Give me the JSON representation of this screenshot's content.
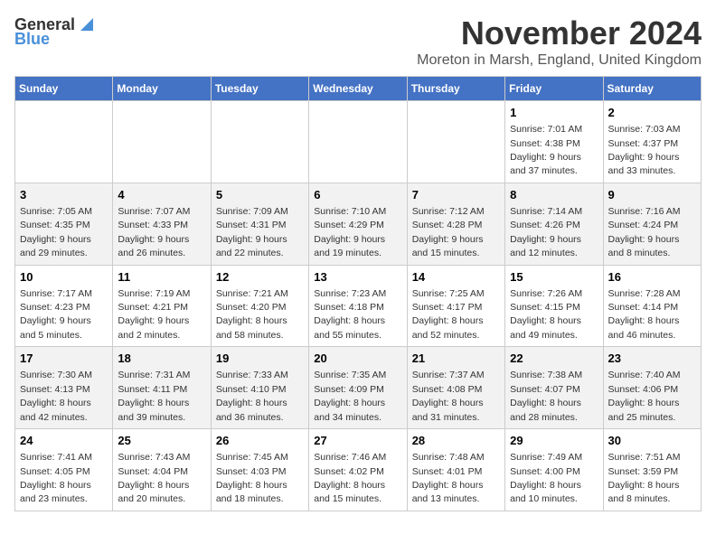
{
  "logo": {
    "general": "General",
    "blue": "Blue"
  },
  "title": "November 2024",
  "location": "Moreton in Marsh, England, United Kingdom",
  "headers": [
    "Sunday",
    "Monday",
    "Tuesday",
    "Wednesday",
    "Thursday",
    "Friday",
    "Saturday"
  ],
  "weeks": [
    [
      {
        "day": "",
        "info": ""
      },
      {
        "day": "",
        "info": ""
      },
      {
        "day": "",
        "info": ""
      },
      {
        "day": "",
        "info": ""
      },
      {
        "day": "",
        "info": ""
      },
      {
        "day": "1",
        "info": "Sunrise: 7:01 AM\nSunset: 4:38 PM\nDaylight: 9 hours\nand 37 minutes."
      },
      {
        "day": "2",
        "info": "Sunrise: 7:03 AM\nSunset: 4:37 PM\nDaylight: 9 hours\nand 33 minutes."
      }
    ],
    [
      {
        "day": "3",
        "info": "Sunrise: 7:05 AM\nSunset: 4:35 PM\nDaylight: 9 hours\nand 29 minutes."
      },
      {
        "day": "4",
        "info": "Sunrise: 7:07 AM\nSunset: 4:33 PM\nDaylight: 9 hours\nand 26 minutes."
      },
      {
        "day": "5",
        "info": "Sunrise: 7:09 AM\nSunset: 4:31 PM\nDaylight: 9 hours\nand 22 minutes."
      },
      {
        "day": "6",
        "info": "Sunrise: 7:10 AM\nSunset: 4:29 PM\nDaylight: 9 hours\nand 19 minutes."
      },
      {
        "day": "7",
        "info": "Sunrise: 7:12 AM\nSunset: 4:28 PM\nDaylight: 9 hours\nand 15 minutes."
      },
      {
        "day": "8",
        "info": "Sunrise: 7:14 AM\nSunset: 4:26 PM\nDaylight: 9 hours\nand 12 minutes."
      },
      {
        "day": "9",
        "info": "Sunrise: 7:16 AM\nSunset: 4:24 PM\nDaylight: 9 hours\nand 8 minutes."
      }
    ],
    [
      {
        "day": "10",
        "info": "Sunrise: 7:17 AM\nSunset: 4:23 PM\nDaylight: 9 hours\nand 5 minutes."
      },
      {
        "day": "11",
        "info": "Sunrise: 7:19 AM\nSunset: 4:21 PM\nDaylight: 9 hours\nand 2 minutes."
      },
      {
        "day": "12",
        "info": "Sunrise: 7:21 AM\nSunset: 4:20 PM\nDaylight: 8 hours\nand 58 minutes."
      },
      {
        "day": "13",
        "info": "Sunrise: 7:23 AM\nSunset: 4:18 PM\nDaylight: 8 hours\nand 55 minutes."
      },
      {
        "day": "14",
        "info": "Sunrise: 7:25 AM\nSunset: 4:17 PM\nDaylight: 8 hours\nand 52 minutes."
      },
      {
        "day": "15",
        "info": "Sunrise: 7:26 AM\nSunset: 4:15 PM\nDaylight: 8 hours\nand 49 minutes."
      },
      {
        "day": "16",
        "info": "Sunrise: 7:28 AM\nSunset: 4:14 PM\nDaylight: 8 hours\nand 46 minutes."
      }
    ],
    [
      {
        "day": "17",
        "info": "Sunrise: 7:30 AM\nSunset: 4:13 PM\nDaylight: 8 hours\nand 42 minutes."
      },
      {
        "day": "18",
        "info": "Sunrise: 7:31 AM\nSunset: 4:11 PM\nDaylight: 8 hours\nand 39 minutes."
      },
      {
        "day": "19",
        "info": "Sunrise: 7:33 AM\nSunset: 4:10 PM\nDaylight: 8 hours\nand 36 minutes."
      },
      {
        "day": "20",
        "info": "Sunrise: 7:35 AM\nSunset: 4:09 PM\nDaylight: 8 hours\nand 34 minutes."
      },
      {
        "day": "21",
        "info": "Sunrise: 7:37 AM\nSunset: 4:08 PM\nDaylight: 8 hours\nand 31 minutes."
      },
      {
        "day": "22",
        "info": "Sunrise: 7:38 AM\nSunset: 4:07 PM\nDaylight: 8 hours\nand 28 minutes."
      },
      {
        "day": "23",
        "info": "Sunrise: 7:40 AM\nSunset: 4:06 PM\nDaylight: 8 hours\nand 25 minutes."
      }
    ],
    [
      {
        "day": "24",
        "info": "Sunrise: 7:41 AM\nSunset: 4:05 PM\nDaylight: 8 hours\nand 23 minutes."
      },
      {
        "day": "25",
        "info": "Sunrise: 7:43 AM\nSunset: 4:04 PM\nDaylight: 8 hours\nand 20 minutes."
      },
      {
        "day": "26",
        "info": "Sunrise: 7:45 AM\nSunset: 4:03 PM\nDaylight: 8 hours\nand 18 minutes."
      },
      {
        "day": "27",
        "info": "Sunrise: 7:46 AM\nSunset: 4:02 PM\nDaylight: 8 hours\nand 15 minutes."
      },
      {
        "day": "28",
        "info": "Sunrise: 7:48 AM\nSunset: 4:01 PM\nDaylight: 8 hours\nand 13 minutes."
      },
      {
        "day": "29",
        "info": "Sunrise: 7:49 AM\nSunset: 4:00 PM\nDaylight: 8 hours\nand 10 minutes."
      },
      {
        "day": "30",
        "info": "Sunrise: 7:51 AM\nSunset: 3:59 PM\nDaylight: 8 hours\nand 8 minutes."
      }
    ]
  ]
}
